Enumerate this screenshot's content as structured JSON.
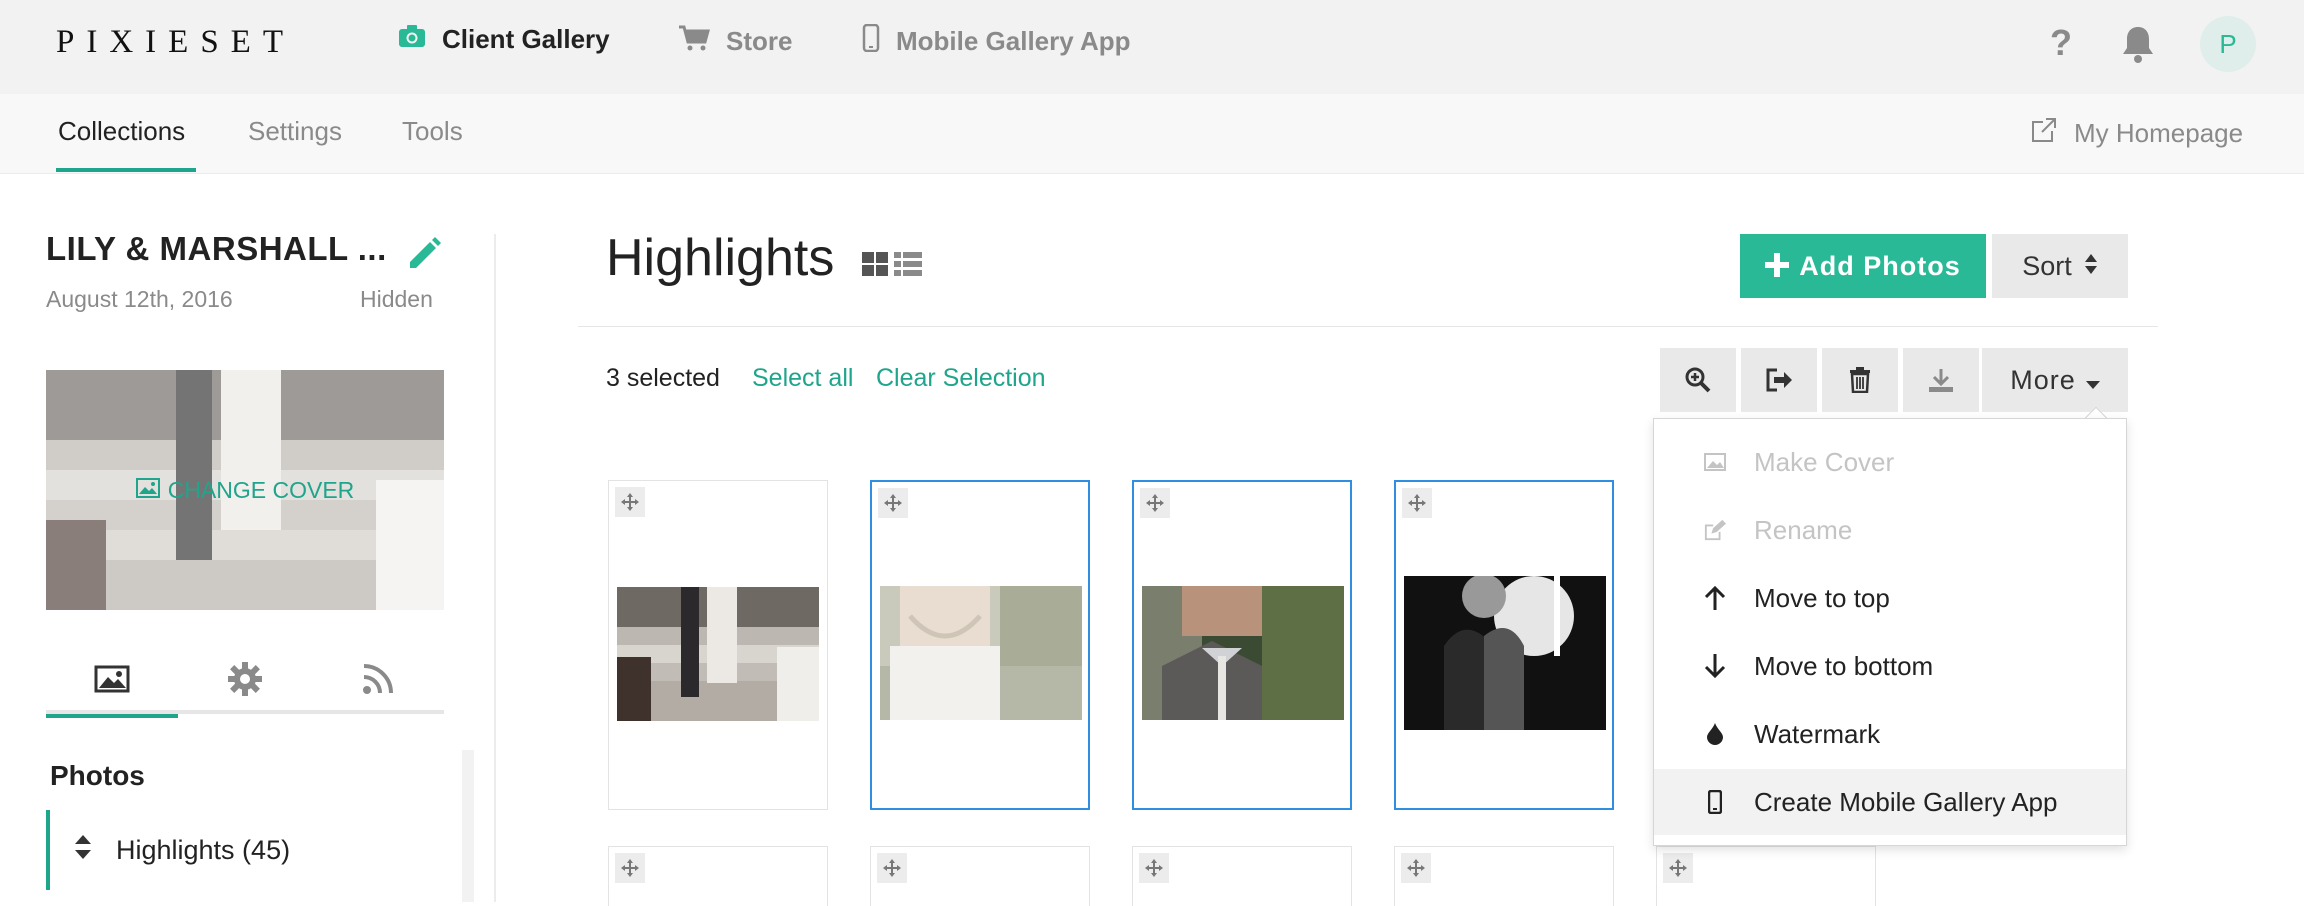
{
  "brand": {
    "logo": "PIXIESET"
  },
  "topnav": {
    "client_gallery": "Client Gallery",
    "store": "Store",
    "mobile_app": "Mobile Gallery App",
    "help": "?",
    "avatar": "P"
  },
  "subnav": {
    "tabs": [
      "Collections",
      "Settings",
      "Tools"
    ],
    "active": "Collections",
    "homepage": "My Homepage"
  },
  "sidebar": {
    "collection_title": "LILY & MARSHALL ...",
    "date": "August 12th, 2016",
    "status": "Hidden",
    "change_cover": "CHANGE COVER",
    "photos_heading": "Photos",
    "sets": [
      {
        "label": "Highlights (45)"
      }
    ]
  },
  "main": {
    "title": "Highlights",
    "add_photos": "Add Photos",
    "sort": "Sort",
    "selected_count": "3 selected",
    "select_all": "Select all",
    "clear_selection": "Clear Selection",
    "more": "More"
  },
  "more_menu": [
    {
      "label": "Make Cover",
      "icon": "image-icon",
      "disabled": true
    },
    {
      "label": "Rename",
      "icon": "edit-icon",
      "disabled": true
    },
    {
      "label": "Move to top",
      "icon": "arrow-up-icon",
      "disabled": false
    },
    {
      "label": "Move to bottom",
      "icon": "arrow-down-icon",
      "disabled": false
    },
    {
      "label": "Watermark",
      "icon": "drop-icon",
      "disabled": false
    },
    {
      "label": "Create Mobile Gallery App",
      "icon": "mobile-icon",
      "disabled": false,
      "highlighted": true
    }
  ],
  "thumbnails": [
    {
      "selected": false,
      "subject": "wedding couple walking down steps"
    },
    {
      "selected": true,
      "subject": "bride in strapless gown"
    },
    {
      "selected": true,
      "subject": "groom with boutonniere"
    },
    {
      "selected": true,
      "subject": "couple silhouette black and white"
    }
  ],
  "colors": {
    "accent": "#2ab996",
    "selection": "#2f8ee0",
    "text_muted": "#8a8a8a"
  }
}
